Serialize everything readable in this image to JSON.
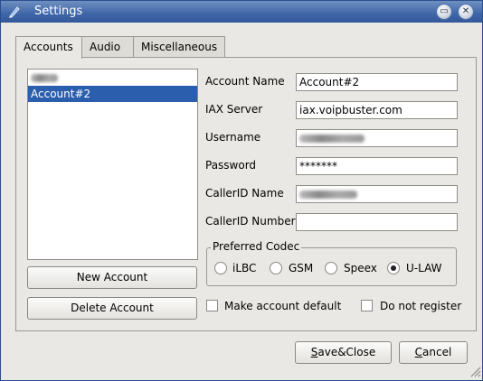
{
  "window": {
    "title": "Settings"
  },
  "tabs": [
    {
      "label": "Accounts",
      "active": true
    },
    {
      "label": "Audio",
      "active": false
    },
    {
      "label": "Miscellaneous",
      "active": false
    }
  ],
  "accounts_list": [
    {
      "label": "",
      "redacted": true,
      "selected": false
    },
    {
      "label": "Account#2",
      "redacted": false,
      "selected": true
    }
  ],
  "buttons": {
    "new_account": "New Account",
    "delete_account": "Delete Account",
    "save_close": {
      "underline": "S",
      "rest": "ave&Close"
    },
    "cancel": {
      "underline": "C",
      "rest": "ancel"
    }
  },
  "form": {
    "account_name": {
      "label": "Account Name",
      "value": "Account#2"
    },
    "iax_server": {
      "label": "IAX Server",
      "value": "iax.voipbuster.com"
    },
    "username": {
      "label": "Username",
      "value": "",
      "redacted": true
    },
    "password": {
      "label": "Password",
      "value": "*******"
    },
    "callerid_name": {
      "label": "CallerID Name",
      "value": "",
      "redacted": true
    },
    "callerid_number": {
      "label": "CallerID Number",
      "value": ""
    }
  },
  "codec": {
    "title": "Preferred Codec",
    "options": [
      {
        "label": "iLBC",
        "checked": false
      },
      {
        "label": "GSM",
        "checked": false
      },
      {
        "label": "Speex",
        "checked": false
      },
      {
        "label": "U-LAW",
        "checked": true
      }
    ]
  },
  "checkboxes": {
    "make_default": {
      "label": "Make account default",
      "checked": false
    },
    "do_not_register": {
      "label": "Do not register",
      "checked": false
    }
  },
  "icons": {
    "app": "pen-icon",
    "maximize": "maximize-icon",
    "close": "close-icon",
    "resize": "resize-grip-icon"
  },
  "colors": {
    "titlebar": "#3e66a8",
    "selection": "#2c5eae",
    "background": "#e9e8e4"
  }
}
